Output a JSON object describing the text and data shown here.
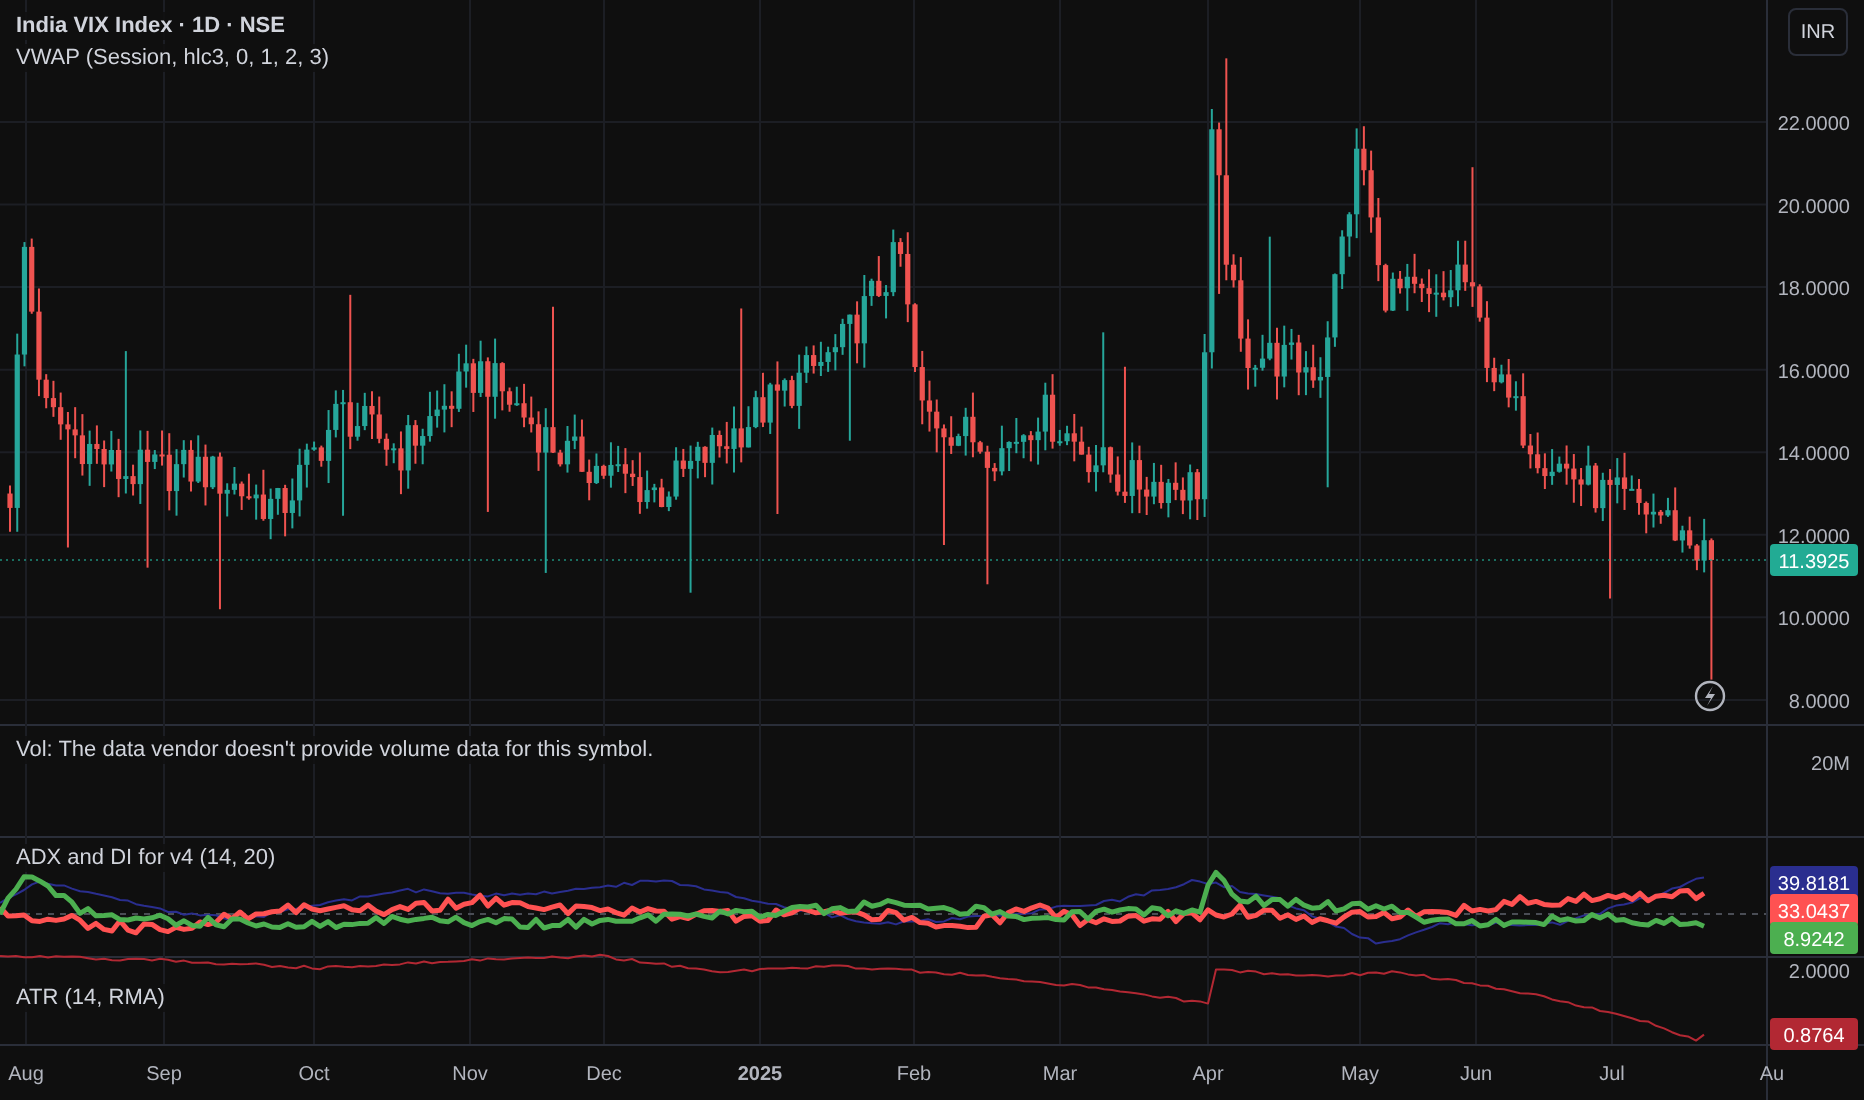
{
  "header": {
    "symbol": "India VIX Index · 1D · NSE",
    "indicator": "VWAP (Session, hlc3, 0, 1, 2, 3)"
  },
  "currency_button": "INR",
  "price_axis": [
    "22.0000",
    "20.0000",
    "18.0000",
    "16.0000",
    "14.0000",
    "12.0000",
    "10.0000",
    "8.0000"
  ],
  "last_price": {
    "value": "11.3925",
    "color": "#22ab94"
  },
  "volume_pane": {
    "note": "Vol: The data vendor doesn't provide volume data for this symbol.",
    "axis": "20M"
  },
  "adx_pane": {
    "legend": "ADX and DI for v4 (14, 20)",
    "tags": [
      {
        "value": "39.8181",
        "color": "#2a2e8f"
      },
      {
        "value": "33.0437",
        "color": "#ff5252"
      },
      {
        "value": "8.9242",
        "color": "#4caf50"
      }
    ]
  },
  "atr_pane": {
    "legend": "ATR (14, RMA)",
    "axis": "2.0000",
    "tag": {
      "value": "0.8764",
      "color": "#b22833"
    }
  },
  "time_axis": [
    "Aug",
    "Sep",
    "Oct",
    "Nov",
    "Dec",
    "2025",
    "Feb",
    "Mar",
    "Apr",
    "May",
    "Jun",
    "Jul",
    "Au"
  ]
}
